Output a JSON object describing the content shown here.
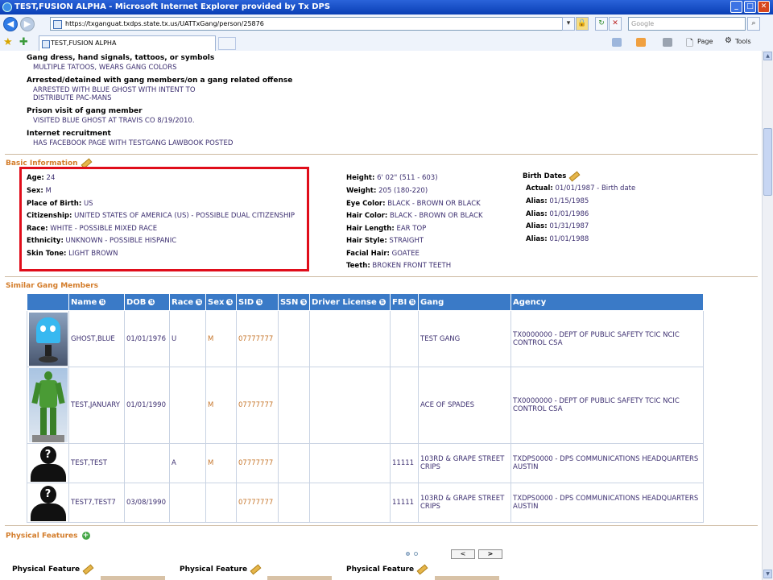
{
  "window": {
    "title": "TEST,FUSION ALPHA - Microsoft Internet Explorer provided by Tx DPS",
    "minimize": "_",
    "maximize": "□",
    "close": "✕"
  },
  "address": {
    "url": "https://txganguat.txdps.state.tx.us/UATTxGang/person/25876",
    "search_placeholder": "Google"
  },
  "tab": {
    "label": "TEST,FUSION ALPHA"
  },
  "commandbar": {
    "page": "Page",
    "tools": "Tools"
  },
  "indicators": [
    {
      "label": "Gang dress, hand signals, tattoos, or symbols",
      "lines": [
        "MULTIPLE TATOOS, WEARS GANG COLORS"
      ]
    },
    {
      "label": "Arrested/detained with gang members/on a gang related offense",
      "lines": [
        "ARRESTED WITH BLUE GHOST WITH INTENT TO",
        "DISTRIBUTE PAC-MANS"
      ]
    },
    {
      "label": "Prison visit of gang member",
      "lines": [
        "VISITED BLUE GHOST AT TRAVIS CO 8/19/2010."
      ]
    },
    {
      "label": "Internet recruitment",
      "lines": [
        "HAS FACEBOOK PAGE WITH TESTGANG LAWBOOK POSTED"
      ]
    }
  ],
  "basic_info": {
    "title": "Basic Information",
    "left": [
      {
        "label": "Age:",
        "value": "24"
      },
      {
        "label": "Sex:",
        "value": "M"
      },
      {
        "label": "Place of Birth:",
        "value": "US"
      },
      {
        "label": "Citizenship:",
        "value": "UNITED STATES OF AMERICA (US) - POSSIBLE DUAL CITIZENSHIP"
      },
      {
        "label": "Race:",
        "value": "WHITE - POSSIBLE MIXED RACE"
      },
      {
        "label": "Ethnicity:",
        "value": "UNKNOWN - POSSIBLE HISPANIC"
      },
      {
        "label": "Skin Tone:",
        "value": "LIGHT BROWN"
      }
    ],
    "middle": [
      {
        "label": "Height:",
        "value": "6' 02\" (511 - 603)"
      },
      {
        "label": "Weight:",
        "value": "205 (180-220)"
      },
      {
        "label": "Eye Color:",
        "value": "BLACK - BROWN OR BLACK"
      },
      {
        "label": "Hair Color:",
        "value": "BLACK - BROWN OR BLACK"
      },
      {
        "label": "Hair Length:",
        "value": "EAR TOP"
      },
      {
        "label": "Hair Style:",
        "value": "STRAIGHT"
      },
      {
        "label": "Facial Hair:",
        "value": "GOATEE"
      },
      {
        "label": "Teeth:",
        "value": "BROKEN FRONT TEETH"
      }
    ],
    "birth_dates_title": "Birth Dates",
    "birth_dates": [
      {
        "label": "Actual:",
        "value": "01/01/1987 - Birth date"
      },
      {
        "label": "Alias:",
        "value": "01/15/1985"
      },
      {
        "label": "Alias:",
        "value": "01/01/1986"
      },
      {
        "label": "Alias:",
        "value": "01/31/1987"
      },
      {
        "label": "Alias:",
        "value": "01/01/1988"
      }
    ]
  },
  "similar": {
    "title": "Similar Gang Members",
    "columns": [
      "Name",
      "DOB",
      "Race",
      "Sex",
      "SID",
      "SSN",
      "Driver License",
      "FBI",
      "Gang",
      "Agency"
    ],
    "rows": [
      {
        "photo": "ghost",
        "name": "GHOST,BLUE",
        "dob": "01/01/1976",
        "race": "U",
        "sex": "M",
        "sid": "07777777",
        "ssn": "",
        "dl": "",
        "fbi": "",
        "gang": "TEST GANG",
        "agency": "TX0000000 - DEPT OF PUBLIC SAFETY TCIC NCIC CONTROL CSA"
      },
      {
        "photo": "giant",
        "name": "TEST,JANUARY",
        "dob": "01/01/1990",
        "race": "",
        "sex": "M",
        "sid": "07777777",
        "ssn": "",
        "dl": "",
        "fbi": "",
        "gang": "ACE OF SPADES",
        "agency": "TX0000000 - DEPT OF PUBLIC SAFETY TCIC NCIC CONTROL CSA"
      },
      {
        "photo": "silhouette",
        "name": "TEST,TEST",
        "dob": "",
        "race": "A",
        "sex": "M",
        "sid": "07777777",
        "ssn": "",
        "dl": "",
        "fbi": "11111",
        "gang": "103RD & GRAPE STREET CRIPS",
        "agency": "TXDPS0000 - DPS COMMUNICATIONS HEADQUARTERS AUSTIN"
      },
      {
        "photo": "silhouette",
        "name": "TEST7,TEST7",
        "dob": "03/08/1990",
        "race": "",
        "sex": "",
        "sid": "07777777",
        "ssn": "",
        "dl": "",
        "fbi": "11111",
        "gang": "103RD & GRAPE STREET CRIPS",
        "agency": "TXDPS0000 - DPS COMMUNICATIONS HEADQUARTERS AUSTIN"
      }
    ]
  },
  "physical": {
    "title": "Physical Features",
    "pager_prev": "<",
    "pager_next": ">",
    "items": [
      "Physical Feature",
      "Physical Feature",
      "Physical Feature"
    ]
  },
  "colors": {
    "section_title": "#d37c2a",
    "table_header": "#3a7ac7",
    "highlight_border": "#e00d1a",
    "value_text": "#3c2f70"
  }
}
